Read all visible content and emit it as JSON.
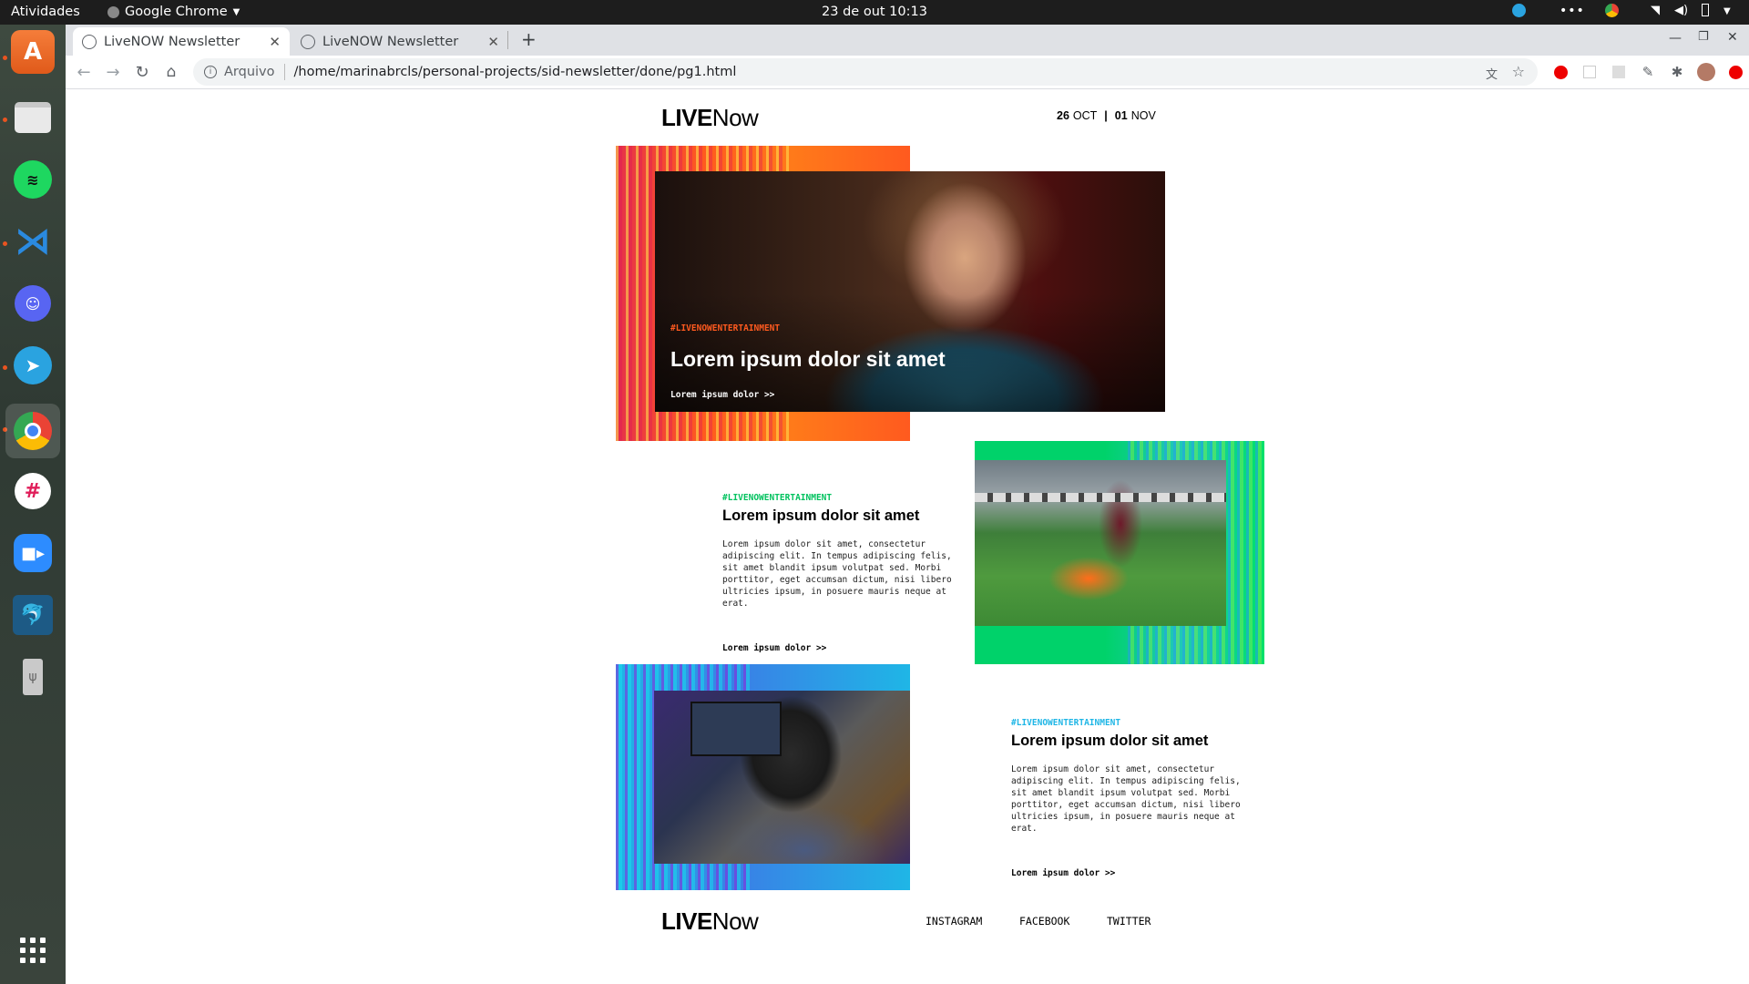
{
  "system_bar": {
    "activities": "Atividades",
    "app_name": "Google Chrome",
    "clock": "23 de out  10:13"
  },
  "dock": {
    "items": [
      {
        "name": "ubuntu-software-icon"
      },
      {
        "name": "files-icon"
      },
      {
        "name": "spotify-icon"
      },
      {
        "name": "vscode-icon"
      },
      {
        "name": "discord-icon"
      },
      {
        "name": "telegram-icon"
      },
      {
        "name": "chrome-icon"
      },
      {
        "name": "slack-icon"
      },
      {
        "name": "zoom-icon"
      },
      {
        "name": "mysql-workbench-icon"
      },
      {
        "name": "usb-drive-icon"
      }
    ]
  },
  "browser": {
    "tabs": [
      {
        "label": "LiveNOW Newsletter",
        "active": true
      },
      {
        "label": "LiveNOW Newsletter",
        "active": false
      }
    ],
    "address": {
      "scheme_label": "Arquivo",
      "url": "/home/marinabrcls/personal-projects/sid-newsletter/done/pg1.html"
    }
  },
  "newsletter": {
    "header": {
      "logo_live": "LIVE",
      "logo_now": "Now",
      "date_day1": "26",
      "date_month1": "OCT",
      "date_sep": "|",
      "date_day2": "01",
      "date_month2": "NOV"
    },
    "hero": {
      "tag": "#LIVENOWENTERTAINMENT",
      "title": "Lorem ipsum dolor sit amet",
      "link": "Lorem ipsum dolor >>"
    },
    "article_sport": {
      "tag": "#LIVENOWENTERTAINMENT",
      "title": "Lorem ipsum dolor sit amet",
      "body": "Lorem ipsum dolor sit amet, consectetur adipiscing elit. In tempus adipiscing felis, sit amet blandit ipsum volutpat sed. Morbi porttitor, eget accumsan dictum, nisi libero ultricies ipsum, in posuere mauris neque at erat.",
      "link": "Lorem ipsum dolor >>"
    },
    "article_music": {
      "tag": "#LIVENOWENTERTAINMENT",
      "title": "Lorem ipsum dolor sit amet",
      "body": "Lorem ipsum dolor sit amet, consectetur adipiscing elit. In tempus adipiscing felis, sit amet blandit ipsum volutpat sed. Morbi porttitor, eget accumsan dictum, nisi libero ultricies ipsum, in posuere mauris neque at erat.",
      "link": "Lorem ipsum dolor >>"
    },
    "footer": {
      "logo_live": "LIVE",
      "logo_now": "Now",
      "social": [
        "INSTAGRAM",
        "FACEBOOK",
        "TWITTER"
      ]
    }
  },
  "colors": {
    "orange": "#ff5a1f",
    "green": "#00d26a",
    "blue": "#1fb6e6",
    "magenta": "#e0185c"
  }
}
